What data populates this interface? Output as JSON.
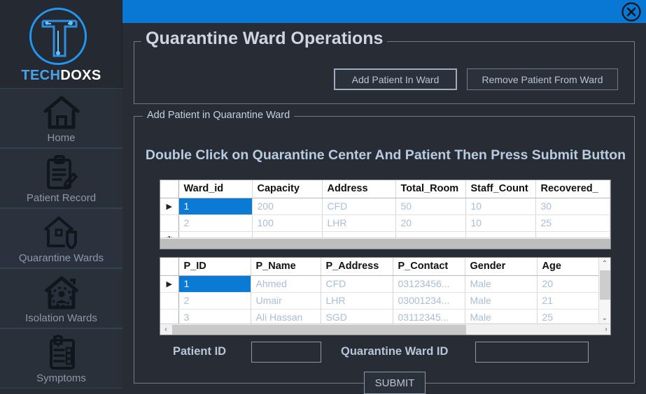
{
  "app": {
    "brand_prefix": "TECH",
    "brand_suffix": "DOXS",
    "close_label": "×"
  },
  "sidebar": {
    "items": [
      {
        "label": "Home",
        "icon": "home-icon"
      },
      {
        "label": "Patient Record",
        "icon": "clipboard-pencil-icon"
      },
      {
        "label": "Quarantine Wards",
        "icon": "house-shield-icon"
      },
      {
        "label": "Isolation Wards",
        "icon": "house-person-icon"
      },
      {
        "label": "Symptoms",
        "icon": "checklist-virus-icon"
      }
    ],
    "active_index": 2,
    "active_accent": "#f2f218"
  },
  "operations": {
    "title": "Quarantine Ward Operations",
    "add_button": "Add Patient In Ward",
    "remove_button": "Remove Patient From Ward"
  },
  "add_panel": {
    "title": "Add Patient  in Quarantine Ward",
    "instruction": "Double Click on Quarantine Center And Patient Then Press Submit Button"
  },
  "wards_grid": {
    "columns": [
      "Ward_id",
      "Capacity",
      "Address",
      "Total_Room",
      "Staff_Count",
      "Recovered_"
    ],
    "rows": [
      {
        "marker": "▶",
        "cells": [
          "1",
          "200",
          "CFD",
          "50",
          "10",
          "30"
        ],
        "selected_col": 0
      },
      {
        "marker": "",
        "cells": [
          "2",
          "100",
          "LHR",
          "20",
          "10",
          "25"
        ],
        "selected_col": -1
      },
      {
        "marker": "✱",
        "cells": [
          "",
          "",
          "",
          "",
          "",
          ""
        ],
        "selected_col": -1
      }
    ]
  },
  "patients_grid": {
    "columns": [
      "P_ID",
      "P_Name",
      "P_Address",
      "P_Contact",
      "Gender",
      "Age"
    ],
    "rows": [
      {
        "marker": "▶",
        "cells": [
          "1",
          "Ahmed",
          "CFD",
          "03123456...",
          "Male",
          "20"
        ],
        "selected_col": 0
      },
      {
        "marker": "",
        "cells": [
          "2",
          "Umair",
          "LHR",
          "03001234...",
          "Male",
          "21"
        ],
        "selected_col": -1
      },
      {
        "marker": "",
        "cells": [
          "3",
          "Ali Hassan",
          "SGD",
          "03112345...",
          "Male",
          "25"
        ],
        "selected_col": -1
      }
    ],
    "scroll_up": "⌃",
    "scroll_down": "⌄",
    "scroll_left": "‹",
    "scroll_right": "›"
  },
  "form": {
    "patient_id_label": "Patient ID",
    "patient_id_value": "",
    "ward_id_label": "Quarantine Ward ID",
    "ward_id_value": "",
    "submit_label": "SUBMIT"
  },
  "colors": {
    "titlebar": "#0878d4",
    "accent_yellow": "#f2f218",
    "selection_blue": "#0a7ad4",
    "panel_bg": "#272c35"
  }
}
